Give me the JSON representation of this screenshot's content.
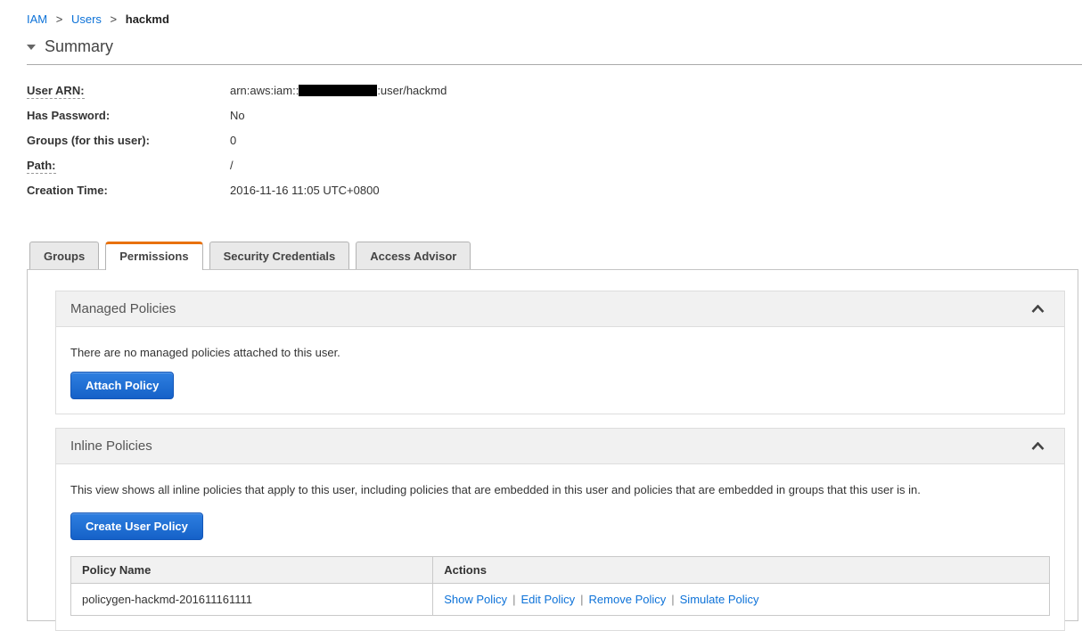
{
  "breadcrumb": {
    "separator": ">",
    "items": [
      {
        "label": "IAM",
        "type": "link"
      },
      {
        "label": "Users",
        "type": "link"
      },
      {
        "label": "hackmd",
        "type": "current"
      }
    ]
  },
  "summary": {
    "title": "Summary",
    "fields": [
      {
        "label": "User ARN:",
        "value_prefix": "arn:aws:iam::",
        "redacted": true,
        "value_suffix": ":user/hackmd"
      },
      {
        "label": "Has Password:",
        "value": "No"
      },
      {
        "label": "Groups (for this user):",
        "value": "0"
      },
      {
        "label": "Path:",
        "value": "/"
      },
      {
        "label": "Creation Time:",
        "value": "2016-11-16 11:05 UTC+0800"
      }
    ]
  },
  "tabs": [
    {
      "label": "Groups"
    },
    {
      "label": "Permissions"
    },
    {
      "label": "Security Credentials"
    },
    {
      "label": "Access Advisor"
    }
  ],
  "active_tab": "Permissions",
  "managed_policies": {
    "title": "Managed Policies",
    "empty_text": "There are no managed policies attached to this user.",
    "attach_button_label": "Attach Policy"
  },
  "inline_policies": {
    "title": "Inline Policies",
    "description": "This view shows all inline policies that apply to this user, including policies that are embedded in this user and policies that are embedded in groups that this user is in.",
    "create_button_label": "Create User Policy",
    "table": {
      "headers": [
        "Policy Name",
        "Actions"
      ],
      "action_separator": "|",
      "rows": [
        {
          "policy_name": "policygen-hackmd-201611161111",
          "actions": [
            "Show Policy",
            "Edit Policy",
            "Remove Policy",
            "Simulate Policy"
          ]
        }
      ]
    }
  },
  "colors": {
    "link_blue": "#0d72d8",
    "tab_active_orange": "#e8710d",
    "button_blue_top": "#2e7fe0",
    "button_blue_bottom": "#1561c8",
    "section_header_bg": "#f1f1f1",
    "redaction_black": "#000000"
  }
}
